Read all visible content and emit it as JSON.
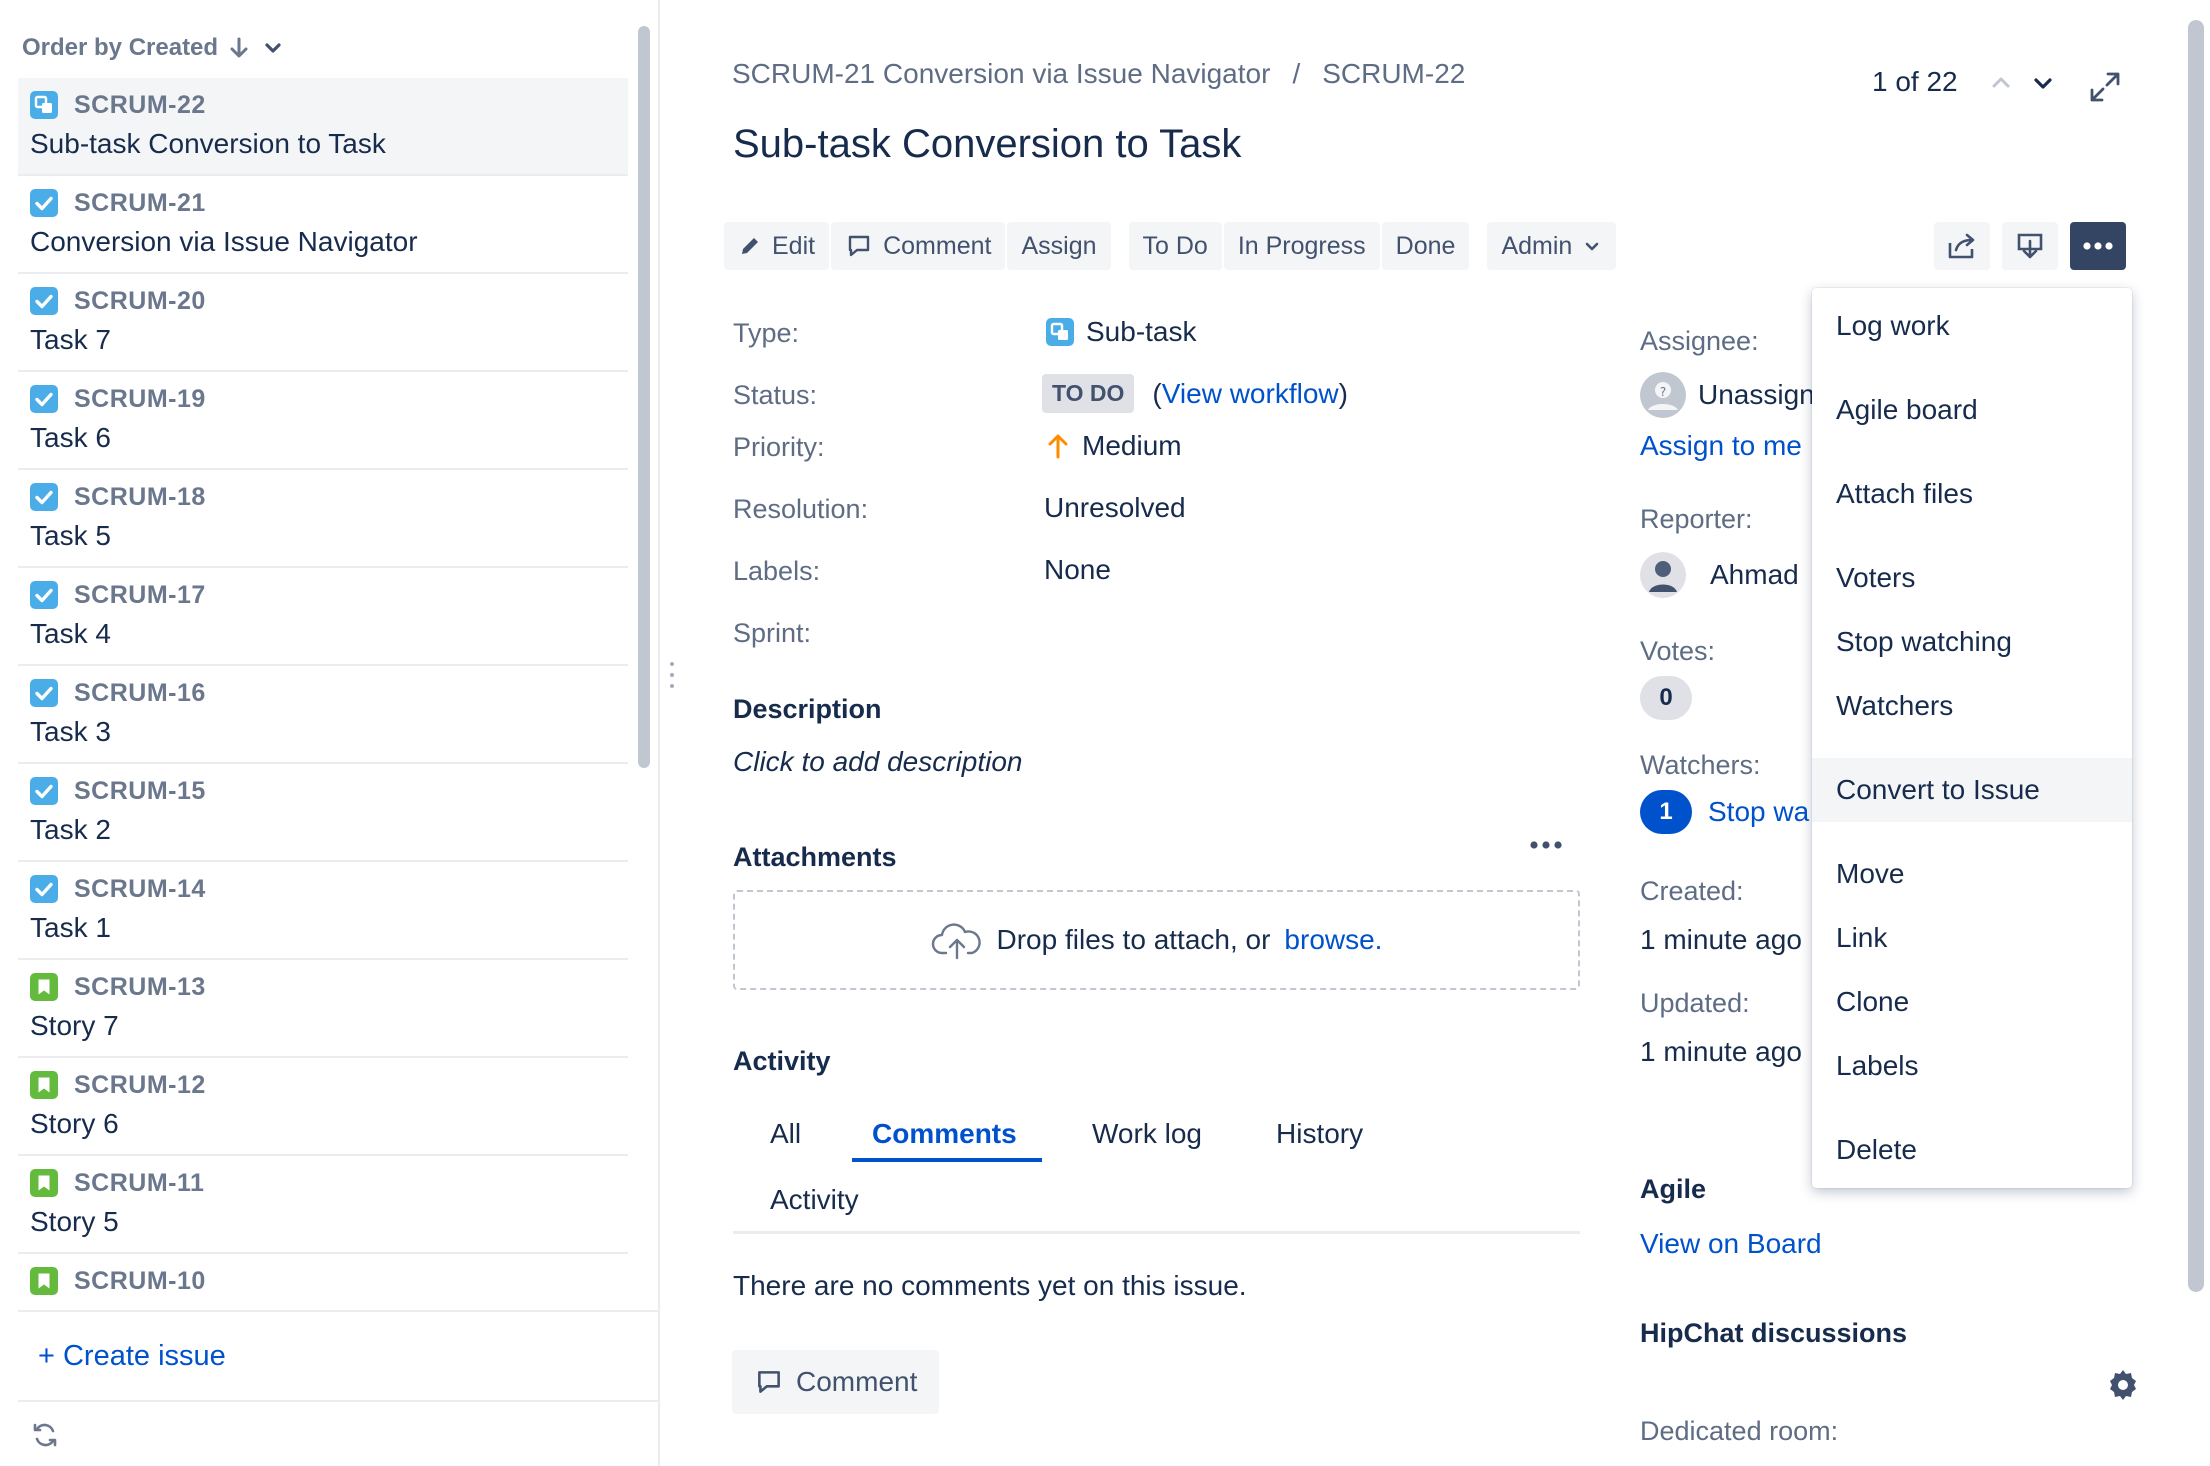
{
  "list": {
    "order_label": "Order by Created",
    "items": [
      {
        "key": "SCRUM-22",
        "summary": "Sub-task Conversion to Task",
        "type": "subtask"
      },
      {
        "key": "SCRUM-21",
        "summary": "Conversion via Issue Navigator",
        "type": "task"
      },
      {
        "key": "SCRUM-20",
        "summary": "Task 7",
        "type": "task"
      },
      {
        "key": "SCRUM-19",
        "summary": "Task 6",
        "type": "task"
      },
      {
        "key": "SCRUM-18",
        "summary": "Task 5",
        "type": "task"
      },
      {
        "key": "SCRUM-17",
        "summary": "Task 4",
        "type": "task"
      },
      {
        "key": "SCRUM-16",
        "summary": "Task 3",
        "type": "task"
      },
      {
        "key": "SCRUM-15",
        "summary": "Task 2",
        "type": "task"
      },
      {
        "key": "SCRUM-14",
        "summary": "Task 1",
        "type": "task"
      },
      {
        "key": "SCRUM-13",
        "summary": "Story 7",
        "type": "story"
      },
      {
        "key": "SCRUM-12",
        "summary": "Story 6",
        "type": "story"
      },
      {
        "key": "SCRUM-11",
        "summary": "Story 5",
        "type": "story"
      },
      {
        "key": "SCRUM-10",
        "summary": "",
        "type": "story"
      }
    ],
    "create_issue": "+ Create issue"
  },
  "header": {
    "breadcrumb_parent": "SCRUM-21 Conversion via Issue Navigator",
    "breadcrumb_sep": "/",
    "breadcrumb_current": "SCRUM-22",
    "pager": "1 of 22",
    "title": "Sub-task Conversion to Task"
  },
  "toolbar": {
    "edit": "Edit",
    "comment": "Comment",
    "assign": "Assign",
    "todo": "To Do",
    "in_progress": "In Progress",
    "done": "Done",
    "admin": "Admin"
  },
  "details": {
    "type_label": "Type:",
    "type_value": "Sub-task",
    "status_label": "Status:",
    "status_value": "TO DO",
    "workflow_open": "(",
    "workflow_link": "View workflow",
    "workflow_close": ")",
    "priority_label": "Priority:",
    "priority_value": "Medium",
    "resolution_label": "Resolution:",
    "resolution_value": "Unresolved",
    "labels_label": "Labels:",
    "labels_value": "None",
    "sprint_label": "Sprint:"
  },
  "description": {
    "title": "Description",
    "placeholder": "Click to add description"
  },
  "attachments": {
    "title": "Attachments",
    "drop_text": "Drop files to attach, or",
    "browse": "browse."
  },
  "activity": {
    "title": "Activity",
    "tabs": [
      "All",
      "Comments",
      "Work log",
      "History",
      "Activity"
    ],
    "empty": "There are no comments yet on this issue.",
    "comment_button": "Comment"
  },
  "people": {
    "assignee_label": "Assignee:",
    "assignee_value": "Unassign",
    "assign_to_me": "Assign to me",
    "reporter_label": "Reporter:",
    "reporter_value": "Ahmad",
    "votes_label": "Votes:",
    "votes_count": "0",
    "watchers_label": "Watchers:",
    "watchers_count": "1",
    "watch_link": "Stop wa",
    "created_label": "Created:",
    "created_value": "1 minute ago",
    "updated_label": "Updated:",
    "updated_value": "1 minute ago",
    "agile_title": "Agile",
    "view_on_board": "View on Board",
    "hipchat_title": "HipChat discussions",
    "dedicated_room": "Dedicated room:"
  },
  "menu": {
    "items": [
      "Log work",
      "Agile board",
      "Attach files",
      "Voters",
      "Stop watching",
      "Watchers",
      "Convert to Issue",
      "Move",
      "Link",
      "Clone",
      "Labels",
      "Delete"
    ]
  },
  "colors": {
    "link": "#0052cc",
    "task_icon": "#4bade8",
    "story_icon": "#63ba3c",
    "priority_medium": "#ff8b00"
  }
}
